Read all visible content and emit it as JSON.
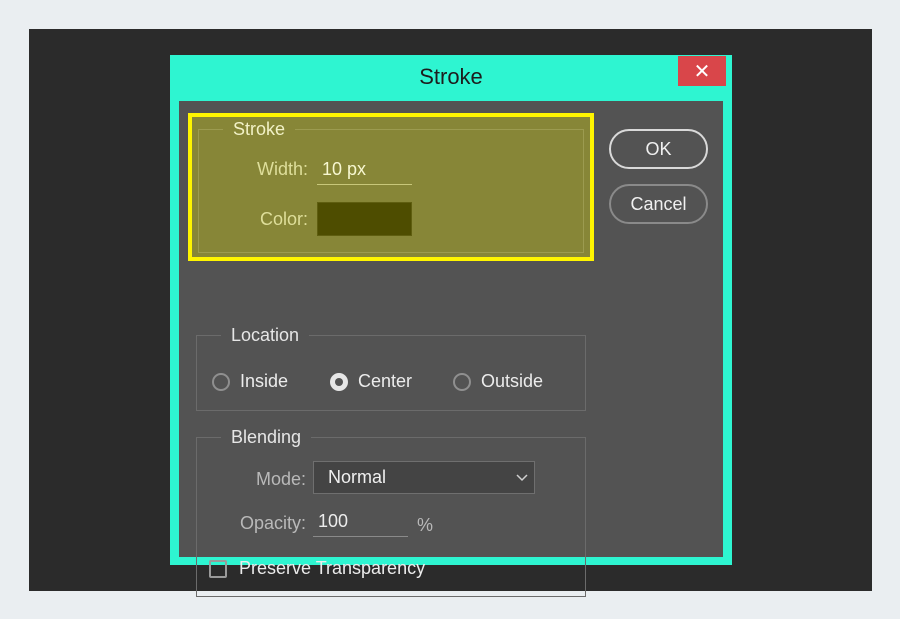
{
  "dialog": {
    "title": "Stroke",
    "close_glyph": "✕"
  },
  "stroke": {
    "legend": "Stroke",
    "width_label": "Width:",
    "width_value": "10 px",
    "color_label": "Color:",
    "color_value": "#4e4d00",
    "highlight_color": "#fff500"
  },
  "location": {
    "legend": "Location",
    "options": [
      "Inside",
      "Center",
      "Outside"
    ],
    "selected": "Center"
  },
  "blending": {
    "legend": "Blending",
    "mode_label": "Mode:",
    "mode_value": "Normal",
    "opacity_label": "Opacity:",
    "opacity_value": "100",
    "opacity_unit": "%",
    "preserve_label": "Preserve Transparency",
    "preserve_checked": false
  },
  "buttons": {
    "ok": "OK",
    "cancel": "Cancel"
  },
  "colors": {
    "title_bar": "#2ef5d1",
    "close_button": "#d9464a",
    "panel": "#535353",
    "backdrop": "#2b2b2b"
  }
}
